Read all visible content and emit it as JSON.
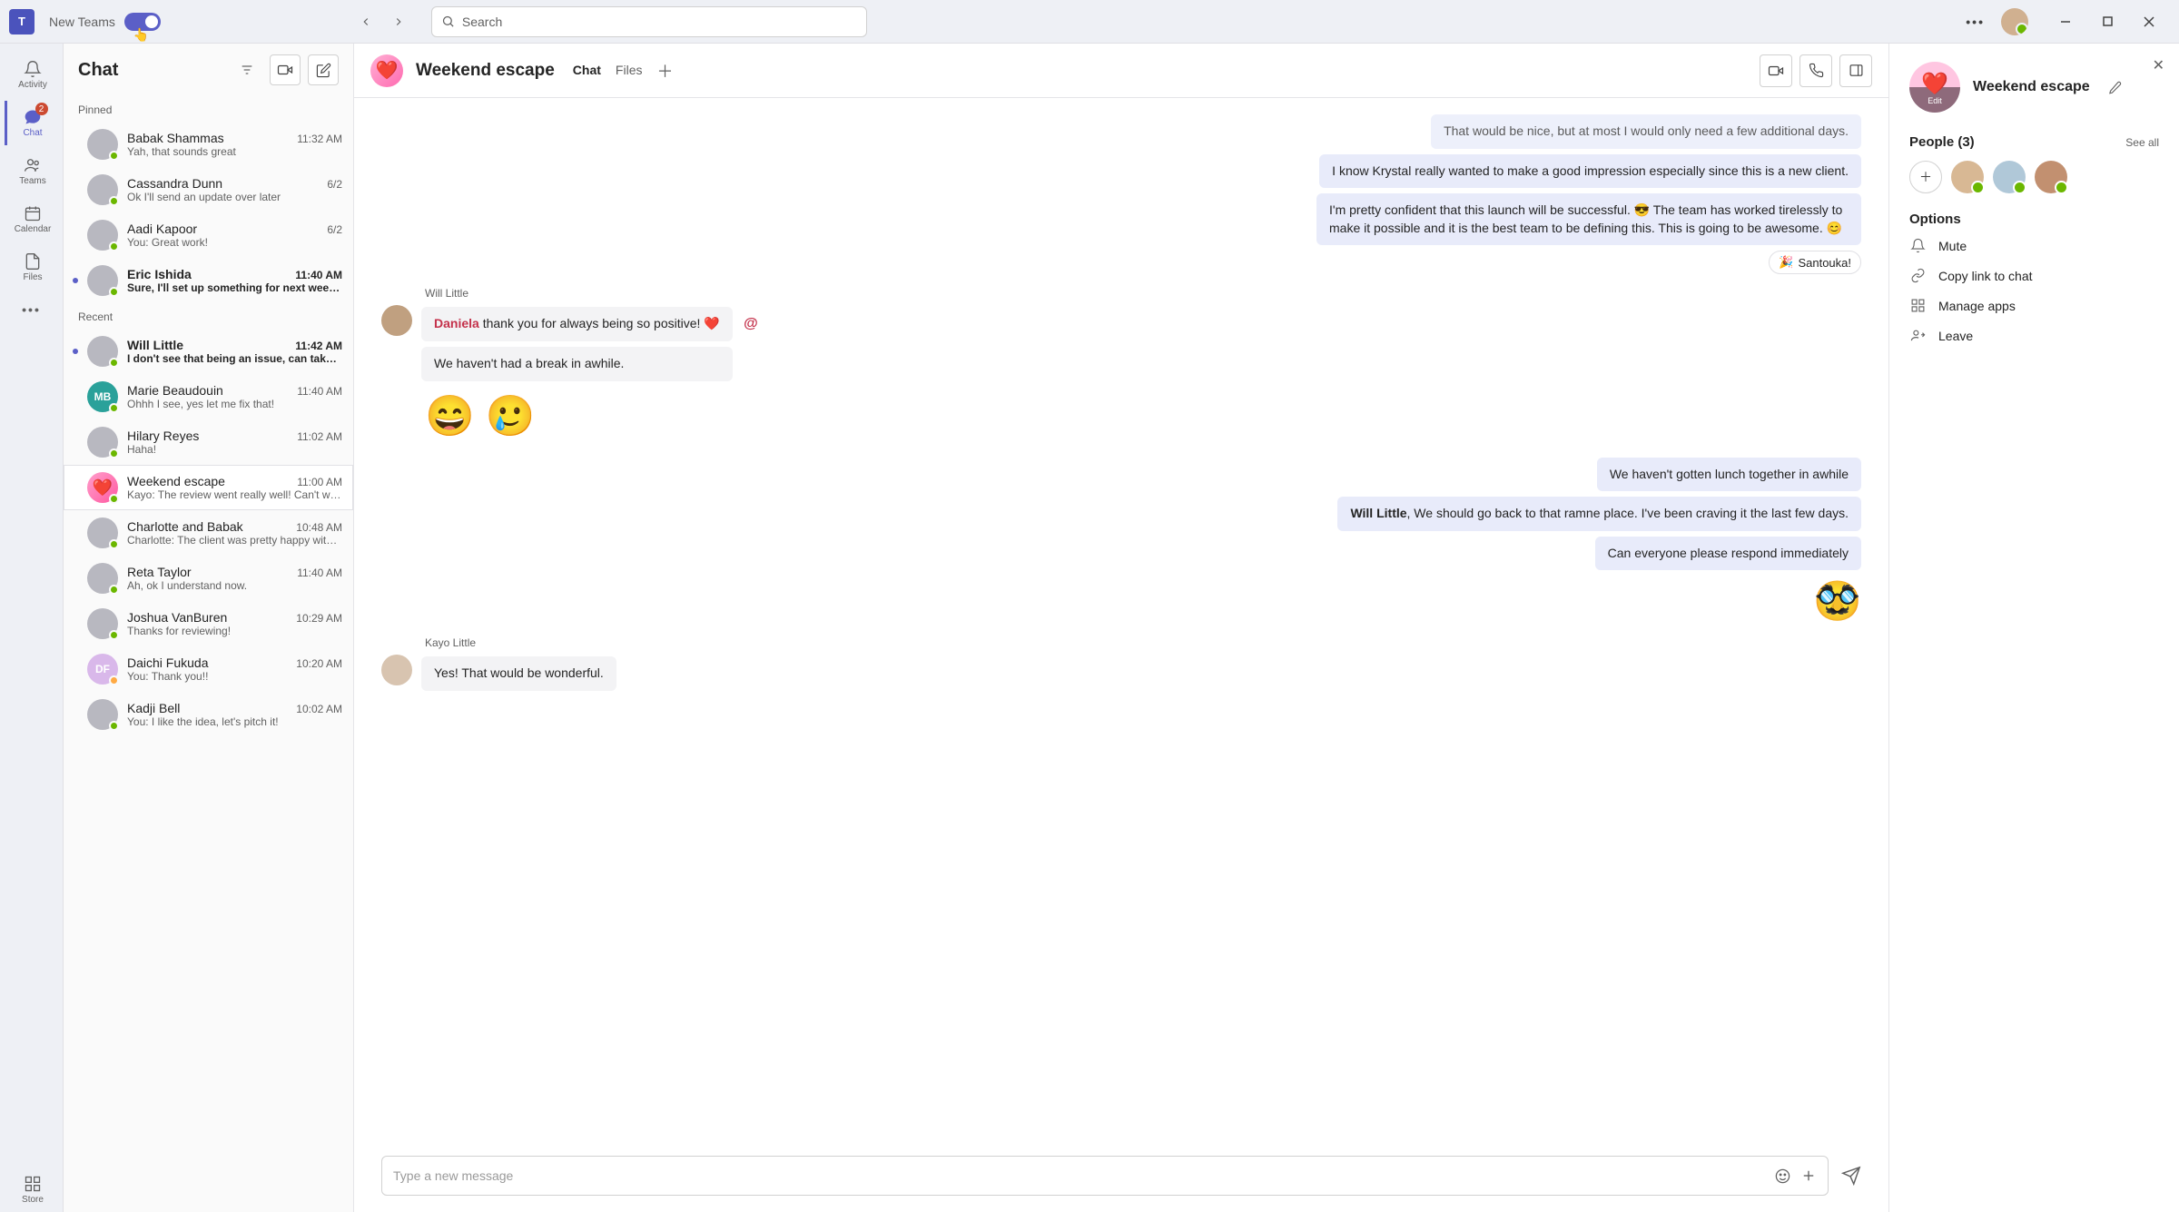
{
  "titlebar": {
    "new_teams_label": "New Teams",
    "search_placeholder": "Search"
  },
  "rail": {
    "activity": "Activity",
    "chat": "Chat",
    "chat_badge": "2",
    "teams": "Teams",
    "calendar": "Calendar",
    "files": "Files",
    "store": "Store"
  },
  "chatlist": {
    "title": "Chat",
    "pinned_label": "Pinned",
    "recent_label": "Recent",
    "pinned": [
      {
        "name": "Babak Shammas",
        "preview": "Yah, that sounds great",
        "time": "11:32 AM",
        "unread": false,
        "avatar_type": "face"
      },
      {
        "name": "Cassandra Dunn",
        "preview": "Ok I'll send an update over later",
        "time": "6/2",
        "unread": false,
        "avatar_type": "face"
      },
      {
        "name": "Aadi Kapoor",
        "preview": "You: Great work!",
        "time": "6/2",
        "unread": false,
        "avatar_type": "face"
      },
      {
        "name": "Eric Ishida",
        "preview": "Sure, I'll set up something for next week to…",
        "time": "11:40 AM",
        "unread": true,
        "avatar_type": "face"
      }
    ],
    "recent": [
      {
        "name": "Will Little",
        "preview": "I don't see that being an issue, can take t…",
        "time": "11:42 AM",
        "unread": true,
        "avatar_type": "face"
      },
      {
        "name": "Marie Beaudouin",
        "preview": "Ohhh I see, yes let me fix that!",
        "time": "11:40 AM",
        "unread": false,
        "avatar_type": "initials",
        "initials": "MB",
        "color": "#2aa19a"
      },
      {
        "name": "Hilary Reyes",
        "preview": "Haha!",
        "time": "11:02 AM",
        "unread": false,
        "avatar_type": "face"
      },
      {
        "name": "Weekend escape",
        "preview": "Kayo: The review went really well! Can't wai…",
        "time": "11:00 AM",
        "unread": false,
        "avatar_type": "heart",
        "selected": true
      },
      {
        "name": "Charlotte and Babak",
        "preview": "Charlotte: The client was pretty happy with…",
        "time": "10:48 AM",
        "unread": false,
        "avatar_type": "face"
      },
      {
        "name": "Reta Taylor",
        "preview": "Ah, ok I understand now.",
        "time": "11:40 AM",
        "unread": false,
        "avatar_type": "face"
      },
      {
        "name": "Joshua VanBuren",
        "preview": "Thanks for reviewing!",
        "time": "10:29 AM",
        "unread": false,
        "avatar_type": "face"
      },
      {
        "name": "Daichi Fukuda",
        "preview": "You: Thank you!!",
        "time": "10:20 AM",
        "unread": false,
        "avatar_type": "initials",
        "initials": "DF",
        "color": "#d9b8ea",
        "presence": "away"
      },
      {
        "name": "Kadji Bell",
        "preview": "You: I like the idea, let's pitch it!",
        "time": "10:02 AM",
        "unread": false,
        "avatar_type": "face"
      }
    ]
  },
  "conversation": {
    "title": "Weekend escape",
    "tabs": {
      "chat": "Chat",
      "files": "Files"
    },
    "messages": {
      "m0_text": "That would be nice, but at most I would only need a few additional days.",
      "m1_text": "I know Krystal really wanted to make a good impression especially since this is a new client.",
      "m2_text": "I'm pretty confident that this launch will be successful. 😎 The team has worked tirelessly to make it possible and it is the best team to be defining this. This is going to be awesome. 😊",
      "reaction1_emoji": "🎉",
      "reaction1_text": "Santouka!",
      "will_name": "Will Little",
      "m3_mention": "Daniela",
      "m3_text": " thank you for always being so positive! ❤️",
      "m4_text": "We haven't had a break in awhile.",
      "m5_text": "We haven't gotten lunch together in awhile",
      "m6_bold": "Will Little",
      "m6_text": ", We should go back to that ramne place. I've been craving it the last few days.",
      "m7_text": "Can everyone please respond immediately",
      "kayo_name": "Kayo Little",
      "m8_text": "Yes! That would be wonderful."
    },
    "compose_placeholder": "Type a new message"
  },
  "details": {
    "name": "Weekend escape",
    "edit_overlay": "Edit",
    "people_title": "People (3)",
    "see_all": "See all",
    "options_title": "Options",
    "opts": {
      "mute": "Mute",
      "copy": "Copy link to chat",
      "apps": "Manage apps",
      "leave": "Leave"
    }
  }
}
